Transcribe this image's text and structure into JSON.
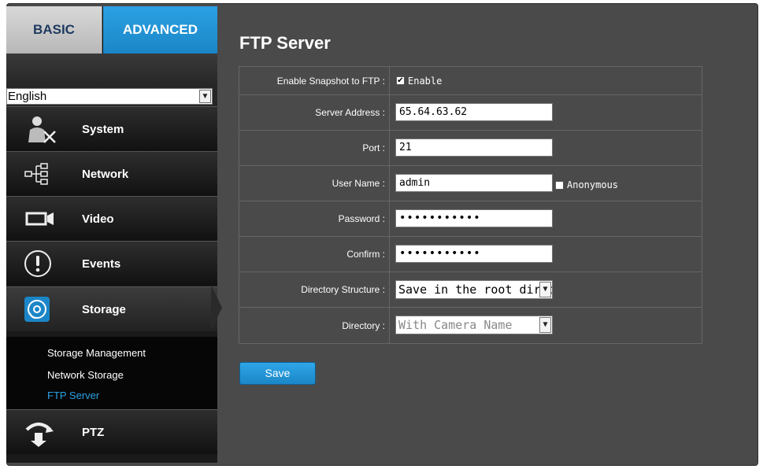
{
  "tabs": {
    "basic": "BASIC",
    "advanced": "ADVANCED"
  },
  "language": {
    "selected": "English"
  },
  "nav": {
    "system": "System",
    "network": "Network",
    "video": "Video",
    "events": "Events",
    "storage": "Storage",
    "ptz": "PTZ"
  },
  "submenu": {
    "storage_management": "Storage Management",
    "network_storage": "Network Storage",
    "ftp_server": "FTP Server"
  },
  "page": {
    "title": "FTP Server"
  },
  "form": {
    "snapshot_label": "Enable Snapshot to FTP :",
    "snapshot_enable_label": "Enable",
    "snapshot_checked": true,
    "server_label": "Server Address :",
    "server_value": "65.64.63.62",
    "port_label": "Port :",
    "port_value": "21",
    "user_label": "User Name :",
    "user_value": "admin",
    "anonymous_label": "Anonymous",
    "anonymous_checked": false,
    "password_label": "Password :",
    "password_value": "•••••••••••",
    "confirm_label": "Confirm :",
    "confirm_value": "•••••••••••",
    "dir_structure_label": "Directory Structure :",
    "dir_structure_value": "Save in the root directory",
    "directory_label": "Directory :",
    "directory_value": "With Camera Name"
  },
  "buttons": {
    "save": "Save"
  },
  "colors": {
    "accent": "#1b86c7",
    "active_link": "#2ba1e3",
    "panel": "#4a4a4a"
  }
}
